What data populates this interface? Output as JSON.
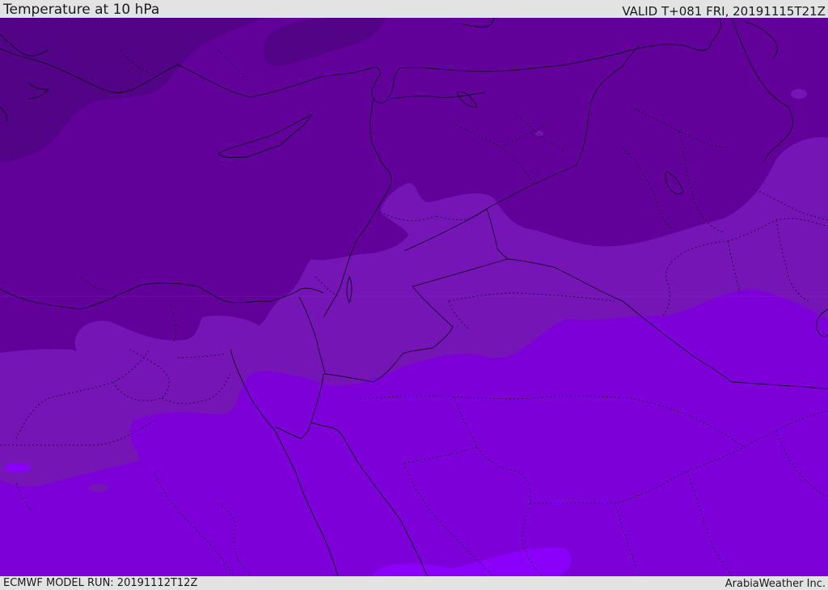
{
  "header": {
    "title": "Temperature at 10 hPa",
    "valid": "VALID T+081 FRI, 20191115T21Z"
  },
  "footer": {
    "model_run": "ECMWF MODEL RUN: 20191112T12Z",
    "credit": "ArabiaWeather Inc."
  },
  "map": {
    "shading_colors": {
      "coldest": "#520386",
      "cold": "#62009a",
      "mid": "#7515b5",
      "warm": "#7d00d8",
      "warmest": "#8a00f8"
    },
    "border_color": "#1a0030"
  }
}
